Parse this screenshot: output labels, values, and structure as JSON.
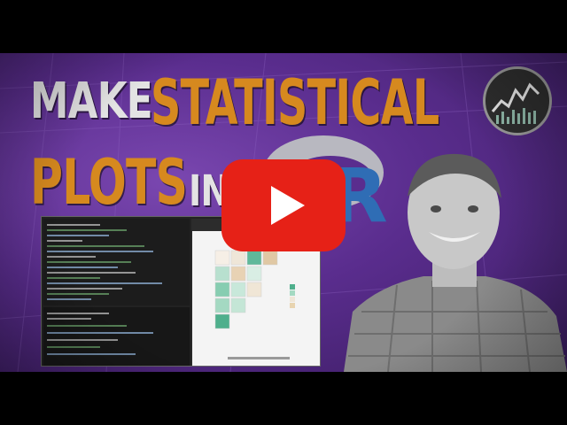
{
  "thumbnail": {
    "title_line1_word1": "MAKE",
    "title_line1_word2": "STATISTICAL",
    "title_line2_word1": "PLOTS",
    "title_line2_word2": "IN",
    "r_logo_letter": "R"
  },
  "colors": {
    "accent_orange": "#d6891f",
    "purple_background": "#5a2d8e",
    "youtube_red": "#e62117",
    "title_white": "#e3e3e3"
  },
  "icons": [
    "play-button-icon",
    "r-logo",
    "channel-logo-icon"
  ]
}
